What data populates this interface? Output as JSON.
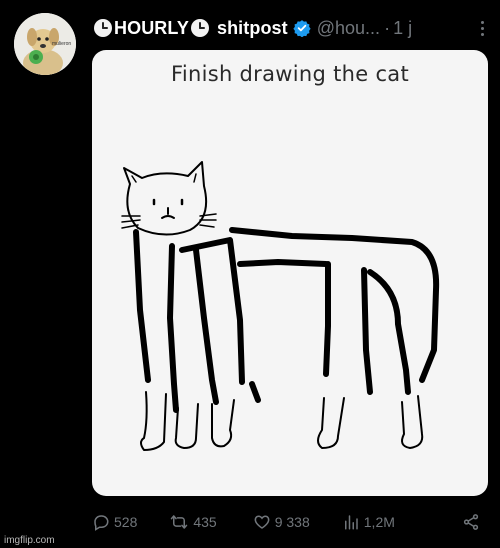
{
  "post": {
    "display_name_part1": "HOURLY",
    "display_name_part2": "shitpost",
    "handle": "@hou...",
    "separator": "·",
    "time": "1 j",
    "avatar_label": "mulieron"
  },
  "media": {
    "caption": "Finish drawing the cat"
  },
  "actions": {
    "replies": "528",
    "reposts": "435",
    "likes": "9 338",
    "views": "1,2M"
  },
  "watermark": "imgflip.com",
  "colors": {
    "background": "#000000",
    "text_primary": "#ffffff",
    "text_secondary": "#71767b",
    "verified": "#1d9bf0",
    "media_bg": "#f5f5f5"
  },
  "icons": [
    "clock-icon",
    "verified-icon",
    "more-icon",
    "reply-icon",
    "repost-icon",
    "like-icon",
    "views-icon",
    "share-icon"
  ]
}
